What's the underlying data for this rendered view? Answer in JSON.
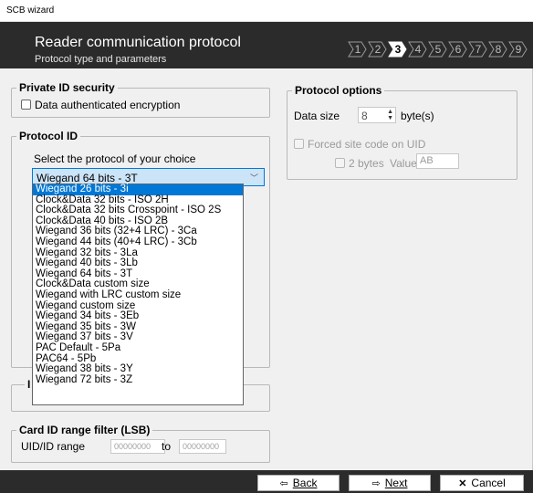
{
  "window": {
    "title": "SCB wizard"
  },
  "header": {
    "title": "Reader communication protocol",
    "subtitle": "Protocol type and parameters",
    "steps": [
      "1",
      "2",
      "3",
      "4",
      "5",
      "6",
      "7",
      "8",
      "9"
    ],
    "active_step": "3"
  },
  "private_id": {
    "legend": "Private ID security",
    "encryption_label": "Data authenticated encryption",
    "encryption_checked": false
  },
  "protocol_id": {
    "legend": "Protocol ID",
    "prompt": "Select the protocol of your choice",
    "selected": "Wiegand 64 bits - 3T",
    "options": [
      "Wiegand 26 bits - 3i",
      "Clock&Data 32 bits - ISO 2H",
      "Clock&Data 32 bits Crosspoint - ISO 2S",
      "Clock&Data 40 bits - ISO 2B",
      "Wiegand 36 bits (32+4 LRC) - 3Ca",
      "Wiegand 44 bits (40+4 LRC) - 3Cb",
      "Wiegand 32 bits - 3La",
      "Wiegand 40 bits - 3Lb",
      "Wiegand 64 bits - 3T",
      "Clock&Data custom size",
      "Wiegand with LRC custom size",
      "Wiegand custom size",
      "Wiegand 34 bits - 3Eb",
      "Wiegand 35 bits - 3W",
      "Wiegand 37 bits - 3V",
      "PAC Default - 5Pa",
      "PAC64 - 5Pb",
      "Wiegand 38 bits - 3Y",
      "Wiegand 72 bits - 3Z"
    ],
    "highlighted": "Wiegand 26 bits - 3i"
  },
  "hidden_group": {
    "legend_partial": "I"
  },
  "protocol_options": {
    "legend": "Protocol options",
    "data_size_label": "Data size",
    "data_size_value": "8",
    "data_size_unit": "byte(s)",
    "forced_site_label": "Forced site code on UID",
    "two_bytes_label": "2 bytes",
    "value_label": "Value",
    "value_text": "AB"
  },
  "card_filter": {
    "legend": "Card ID range filter (LSB)",
    "range_label": "UID/ID range",
    "from_value": "00000000",
    "to_label": "to",
    "to_value": "00000000"
  },
  "buttons": {
    "back": "Back",
    "next": "Next",
    "cancel": "Cancel"
  },
  "colors": {
    "header_bg": "#2b2b2b",
    "selection": "#0078d7",
    "combo_bg": "#cce4f7"
  }
}
